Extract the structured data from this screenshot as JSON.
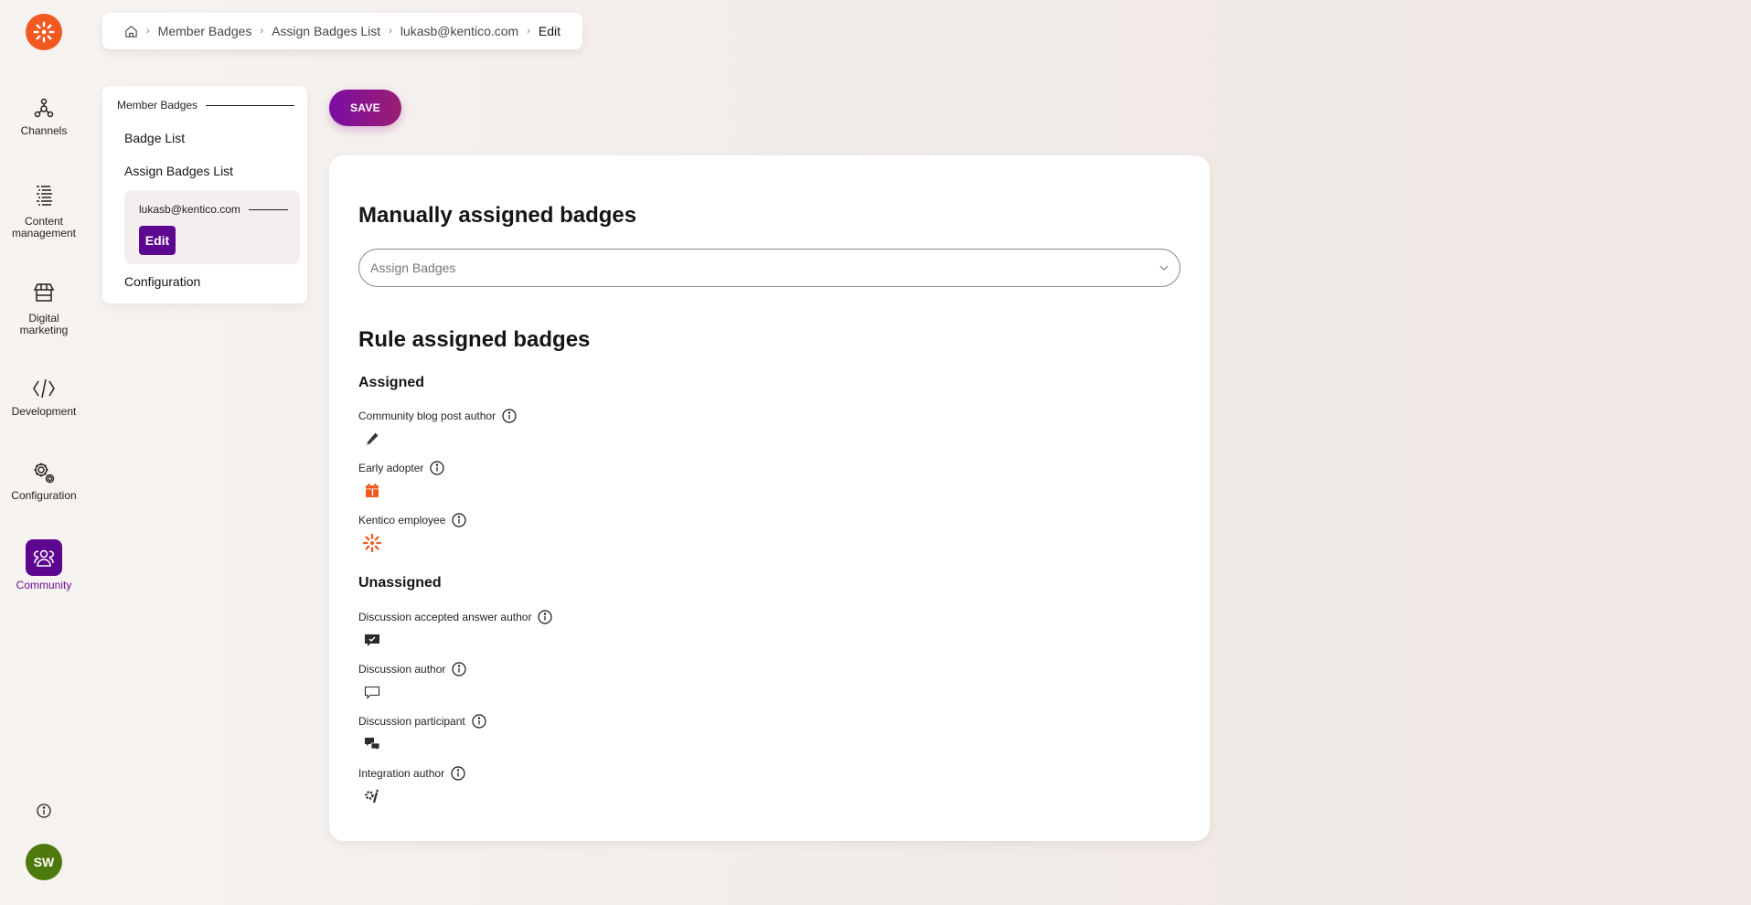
{
  "rail": {
    "items": [
      {
        "label": "Channels",
        "icon": "channels-icon"
      },
      {
        "label_line1": "Content",
        "label_line2": "management",
        "icon": "content-management-icon"
      },
      {
        "label_line1": "Digital",
        "label_line2": "marketing",
        "icon": "digital-marketing-icon"
      },
      {
        "label": "Development",
        "icon": "code-icon"
      },
      {
        "label": "Configuration",
        "icon": "gears-icon"
      },
      {
        "label": "Community",
        "icon": "community-icon",
        "active": true
      }
    ],
    "avatar_initials": "SW"
  },
  "breadcrumb": {
    "items": [
      "Member Badges",
      "Assign Badges List",
      "lukasb@kentico.com",
      "Edit"
    ]
  },
  "sidenav": {
    "group_label": "Member Badges",
    "links": [
      "Badge List",
      "Assign Badges List"
    ],
    "sub_label": "lukasb@kentico.com",
    "sub_action": "Edit",
    "bottom_link": "Configuration"
  },
  "toolbar": {
    "save_label": "SAVE"
  },
  "main": {
    "manual_title": "Manually assigned badges",
    "select_placeholder": "Assign Badges",
    "rule_title": "Rule assigned badges",
    "assigned_label": "Assigned",
    "assigned": [
      {
        "name": "Community blog post author",
        "icon": "pencil-icon"
      },
      {
        "name": "Early adopter",
        "icon": "calendar-icon"
      },
      {
        "name": "Kentico employee",
        "icon": "kentico-logo-icon"
      }
    ],
    "unassigned_label": "Unassigned",
    "unassigned": [
      {
        "name": "Discussion accepted answer author",
        "icon": "message-check-icon"
      },
      {
        "name": "Discussion author",
        "icon": "message-outline-icon"
      },
      {
        "name": "Discussion participant",
        "icon": "messages-icon"
      },
      {
        "name": "Integration author",
        "icon": "integration-icon"
      }
    ]
  },
  "colors": {
    "brand_orange": "#f05a22",
    "accent_purple": "#5d0790",
    "avatar_green": "#4e7a0c"
  }
}
